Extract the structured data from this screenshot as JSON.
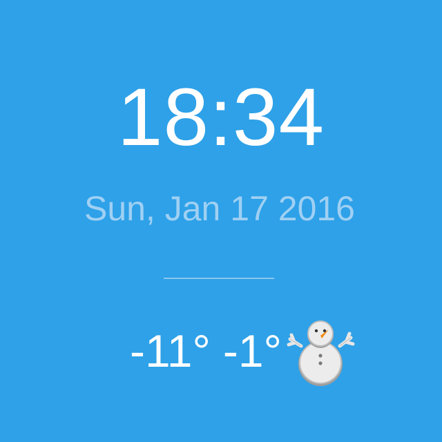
{
  "clock": {
    "time": "18:34",
    "date": "Sun, Jan 17 2016"
  },
  "weather": {
    "low": "-11°",
    "high": "-1°",
    "icon": "snowman-icon"
  },
  "colors": {
    "background": "#2ea1e8",
    "time_text": "#ffffff",
    "date_text": "#9fd0f3",
    "divider": "#8cc7f1"
  }
}
